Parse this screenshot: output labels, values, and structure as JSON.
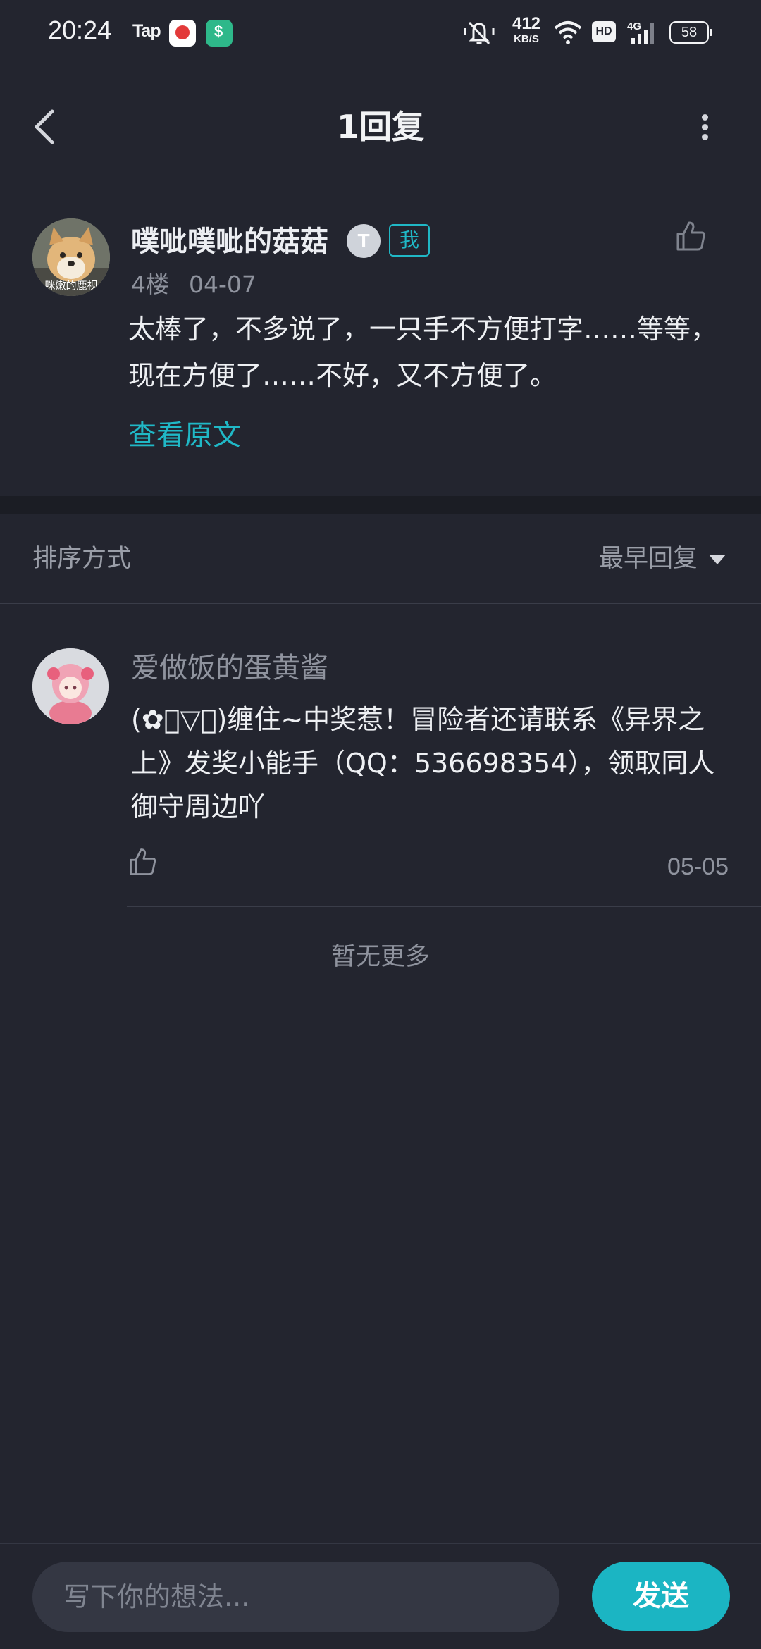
{
  "status_bar": {
    "time": "20:24",
    "tap_label": "Tap",
    "net_speed": "412",
    "net_unit": "KB/S",
    "hd_label": "HD",
    "signal_label": "4G",
    "battery": "58",
    "icons": [
      "app-du-icon",
      "app-shield-icon",
      "mute-bell-icon",
      "wifi-icon",
      "signal-icon",
      "battery-icon"
    ]
  },
  "header": {
    "title": "1回复"
  },
  "main_post": {
    "author": "噗呲噗呲的菇菇",
    "level": "T",
    "me_tag": "我",
    "floor": "4楼",
    "date": "04-07",
    "content": "太棒了，不多说了，一只手不方便打字……等等，现在方便了……不好，又不方便了。",
    "view_original": "查看原文",
    "avatar_caption": "咪嫩的鹿视"
  },
  "sort": {
    "label": "排序方式",
    "selected": "最早回复"
  },
  "replies": [
    {
      "author": "爱做饭的蛋黄酱",
      "content": "(✿ﾟ▽ﾟ)缠住~中奖惹！冒险者还请联系《异界之上》发奖小能手（QQ：536698354），领取同人御守周边吖",
      "date": "05-05"
    }
  ],
  "no_more": "暂无更多",
  "composer": {
    "placeholder": "写下你的想法...",
    "send_label": "发送"
  },
  "colors": {
    "background": "#23252f",
    "accent": "#1bb5c3",
    "muted_text": "#8f939e"
  }
}
